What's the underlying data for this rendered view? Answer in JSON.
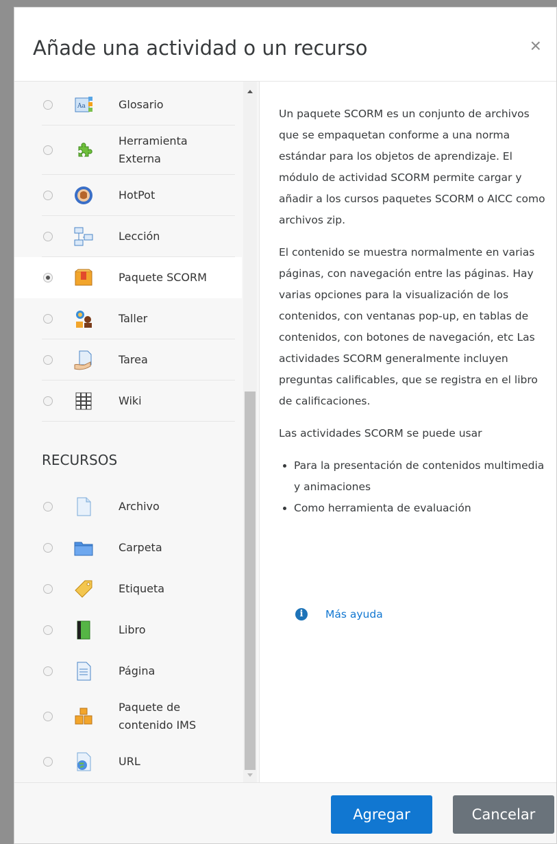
{
  "dialog": {
    "title": "Añade una actividad o un recurso",
    "close_glyph": "×"
  },
  "activities": [
    {
      "label": "Glosario",
      "icon": "glossary-icon",
      "selected": false
    },
    {
      "label": "Herramienta Externa",
      "icon": "external-tool-icon",
      "selected": false
    },
    {
      "label": "HotPot",
      "icon": "hotpot-icon",
      "selected": false
    },
    {
      "label": "Lección",
      "icon": "lesson-icon",
      "selected": false
    },
    {
      "label": "Paquete SCORM",
      "icon": "scorm-package-icon",
      "selected": true
    },
    {
      "label": "Taller",
      "icon": "workshop-icon",
      "selected": false
    },
    {
      "label": "Tarea",
      "icon": "assignment-icon",
      "selected": false
    },
    {
      "label": "Wiki",
      "icon": "wiki-icon",
      "selected": false
    }
  ],
  "resources_heading": "RECURSOS",
  "resources": [
    {
      "label": "Archivo",
      "icon": "file-icon"
    },
    {
      "label": "Carpeta",
      "icon": "folder-icon"
    },
    {
      "label": "Etiqueta",
      "icon": "label-tag-icon"
    },
    {
      "label": "Libro",
      "icon": "book-icon"
    },
    {
      "label": "Página",
      "icon": "page-icon"
    },
    {
      "label": "Paquete de contenido IMS",
      "icon": "ims-package-icon"
    },
    {
      "label": "URL",
      "icon": "url-icon"
    }
  ],
  "help": {
    "paragraph1": "Un paquete SCORM es un conjunto de archivos que se empaquetan conforme a una norma estándar para los objetos de aprendizaje. El módulo de actividad SCORM permite cargar y añadir a los cursos paquetes SCORM o AICC como archivos zip.",
    "paragraph2": "El contenido se muestra normalmente en varias páginas, con navegación entre las páginas. Hay varias opciones para la visualización de los contenidos, con ventanas pop-up, en tablas de contenidos, con botones de navegación, etc Las actividades SCORM generalmente incluyen preguntas calificables, que se registra en el libro de calificaciones.",
    "paragraph3": "Las actividades SCORM se puede usar",
    "bullets": [
      "Para la presentación de contenidos multimedia y animaciones",
      "Como herramienta de evaluación"
    ],
    "more_help_link": "Más ayuda"
  },
  "footer": {
    "add_label": "Agregar",
    "cancel_label": "Cancelar"
  },
  "colors": {
    "primary": "#1177d1",
    "secondary": "#6a737b"
  }
}
